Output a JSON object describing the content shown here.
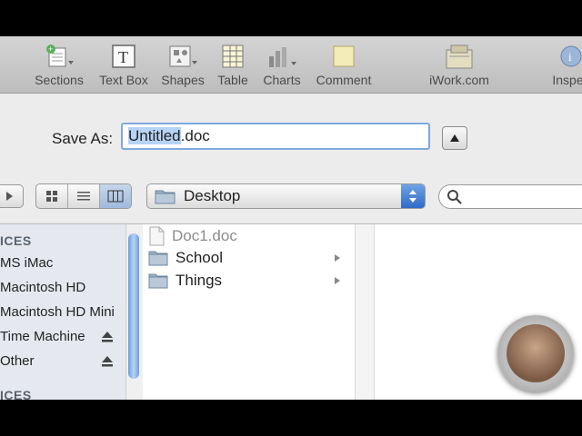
{
  "toolbar": {
    "items": [
      {
        "label": "Sections",
        "icon": "sections-icon"
      },
      {
        "label": "Text Box",
        "icon": "text-box-icon"
      },
      {
        "label": "Shapes",
        "icon": "shapes-icon"
      },
      {
        "label": "Table",
        "icon": "table-icon"
      },
      {
        "label": "Charts",
        "icon": "charts-icon"
      },
      {
        "label": "Comment",
        "icon": "comment-icon"
      },
      {
        "label": "iWork.com",
        "icon": "iwork-icon"
      },
      {
        "label": "Inspec",
        "icon": "inspector-icon"
      }
    ]
  },
  "save": {
    "label": "Save As:",
    "filename_selected": "Untitled",
    "filename_rest": ".doc"
  },
  "location": {
    "current": "Desktop"
  },
  "search": {
    "placeholder": ""
  },
  "sidebar": {
    "header_devices": "ICES",
    "items": [
      {
        "label": "MS iMac",
        "eject": false
      },
      {
        "label": "Macintosh HD",
        "eject": false
      },
      {
        "label": "Macintosh HD Mini",
        "eject": false
      },
      {
        "label": "Time Machine",
        "eject": true
      },
      {
        "label": "Other",
        "eject": true
      }
    ],
    "header_places": "ICES"
  },
  "files": [
    {
      "name": "Doc1.doc",
      "type": "document",
      "dimmed": true
    },
    {
      "name": "School",
      "type": "folder",
      "dimmed": false
    },
    {
      "name": "Things",
      "type": "folder",
      "dimmed": false
    }
  ],
  "colors": {
    "accent": "#2f6bc6",
    "selection": "#b6d3f5"
  }
}
